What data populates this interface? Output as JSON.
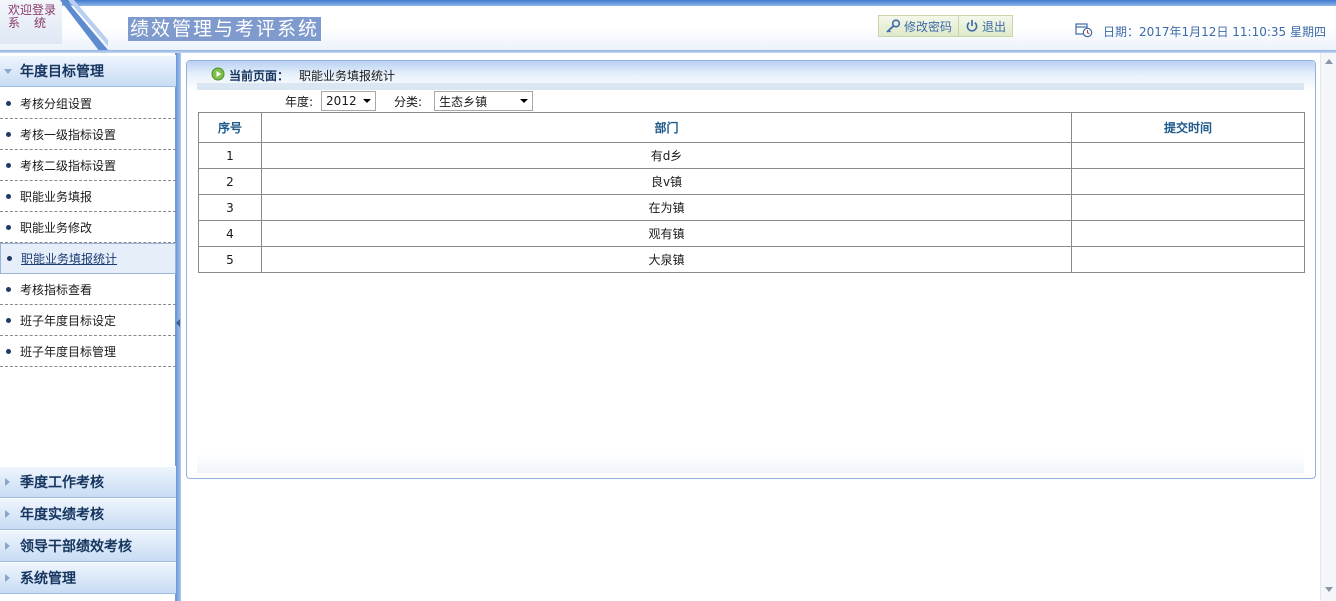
{
  "header": {
    "welcome_line1": "欢迎登录",
    "welcome_line2": "系统",
    "system_title": "绩效管理与考评系统",
    "change_password_label": "修改密码",
    "logout_label": "退出",
    "date_text": "日期：2017年1月12日  11:10:35 星期四",
    "icons": [
      "key-icon",
      "power-icon",
      "clock-icon"
    ]
  },
  "sidebar": {
    "sections": [
      {
        "label": "年度目标管理",
        "expanded": true
      },
      {
        "label": "季度工作考核",
        "expanded": false
      },
      {
        "label": "年度实绩考核",
        "expanded": false
      },
      {
        "label": "领导干部绩效考核",
        "expanded": false
      },
      {
        "label": "系统管理",
        "expanded": false
      }
    ],
    "items": [
      {
        "label": "考核分组设置"
      },
      {
        "label": "考核一级指标设置"
      },
      {
        "label": "考核二级指标设置"
      },
      {
        "label": "职能业务填报"
      },
      {
        "label": "职能业务修改"
      },
      {
        "label": "职能业务填报统计",
        "active": true
      },
      {
        "label": "考核指标查看"
      },
      {
        "label": "班子年度目标设定"
      },
      {
        "label": "班子年度目标管理"
      }
    ]
  },
  "main": {
    "current_page_label": "当前页面：",
    "current_page_value": "职能业务填报统计",
    "filters": {
      "year_label": "年度:",
      "year_value": "2012",
      "category_label": "分类:",
      "category_value": "生态乡镇"
    },
    "table": {
      "columns": [
        "序号",
        "部门",
        "提交时间"
      ],
      "rows": [
        {
          "no": "1",
          "dept": "有d乡",
          "time": ""
        },
        {
          "no": "2",
          "dept": "良v镇",
          "time": ""
        },
        {
          "no": "3",
          "dept": "在为镇",
          "time": ""
        },
        {
          "no": "4",
          "dept": "观有镇",
          "time": ""
        },
        {
          "no": "5",
          "dept": "大泉镇",
          "time": ""
        }
      ]
    }
  },
  "colors": {
    "accent": "#3d6aa8",
    "title_bg": "#7f9acd",
    "table_header_text": "#1f5a8a",
    "sidebar_head_text": "#16355f"
  }
}
